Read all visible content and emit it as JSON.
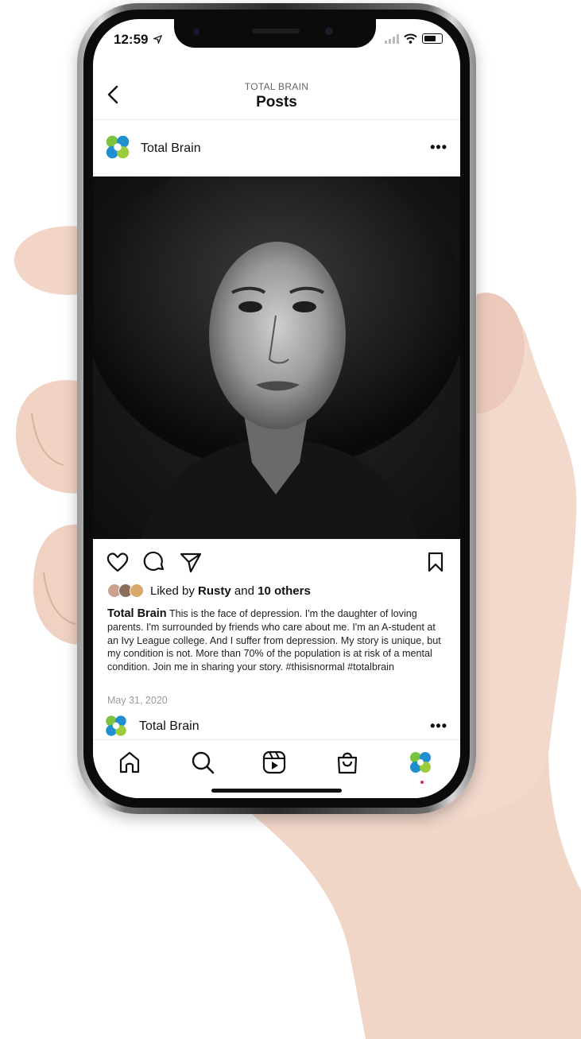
{
  "status": {
    "time": "12:59"
  },
  "header": {
    "subtitle": "TOTAL BRAIN",
    "title": "Posts"
  },
  "post": {
    "account": "Total Brain",
    "liked_by_prefix": "Liked by",
    "liked_by_user": "Rusty",
    "liked_by_and": "and",
    "liked_by_others": "10 others",
    "caption_user": "Total Brain",
    "caption_text": "This is the face of depression. I'm the daughter of loving parents.  I'm surrounded by friends who care about me. I'm an A-student at an Ivy League college. And I suffer from depression. My story is unique, but my condition is not. More than 70% of the population is at risk of a mental condition. Join me in sharing your story. #thisisnormal #totalbrain",
    "date": "May 31, 2020"
  },
  "next_post": {
    "account": "Total Brain"
  },
  "icons": {
    "header": [
      "back-icon"
    ],
    "post_actions": [
      "heart-icon",
      "comment-icon",
      "share-icon",
      "bookmark-icon"
    ],
    "tab_bar": [
      "home-icon",
      "search-icon",
      "reels-icon",
      "shop-icon",
      "profile-avatar"
    ]
  },
  "colors": {
    "brand_green": "#7bc142",
    "brand_blue": "#1f8fcf",
    "notification_dot": "#e0245e"
  }
}
